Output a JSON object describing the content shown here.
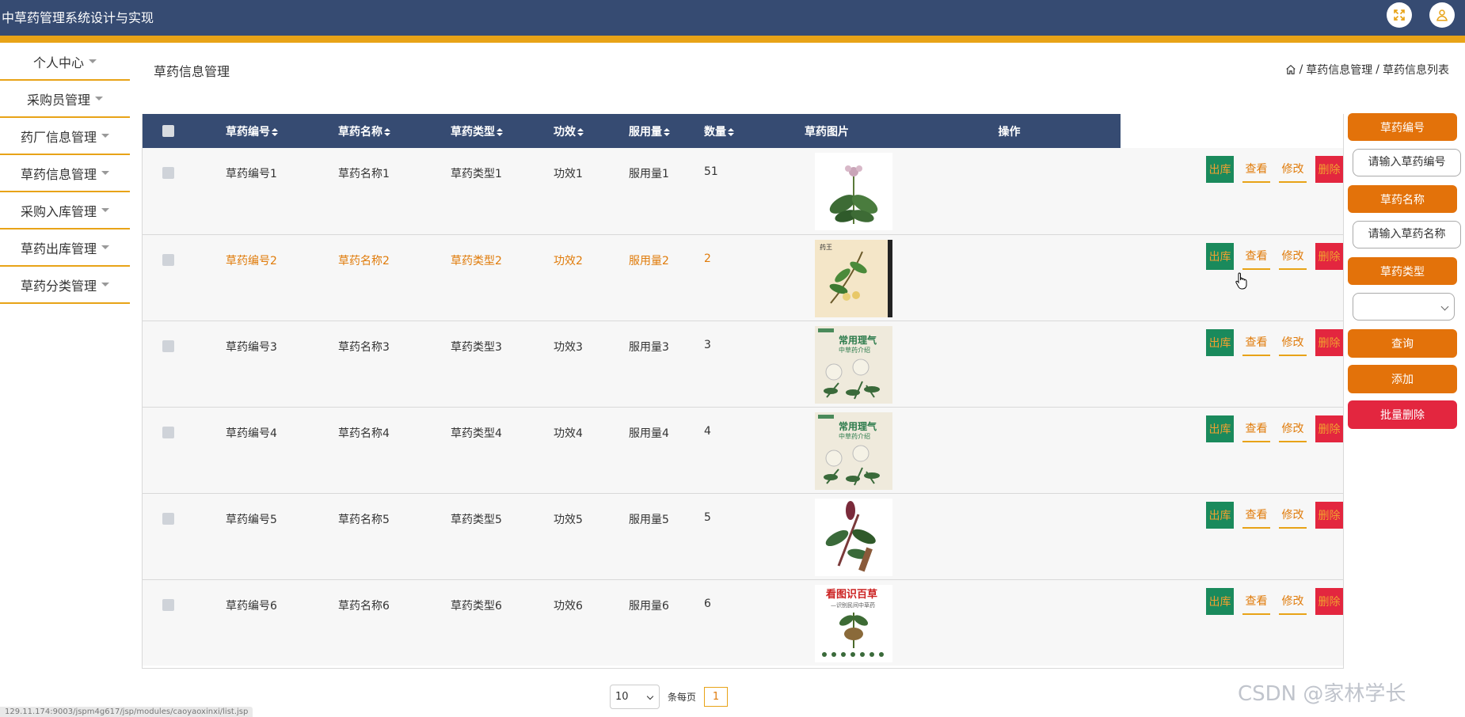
{
  "header": {
    "title": "中草药管理系统设计与实现",
    "fullscreen_icon": "fullscreen-icon",
    "user_icon": "user-icon"
  },
  "sidebar": {
    "items": [
      {
        "label": "个人中心"
      },
      {
        "label": "采购员管理"
      },
      {
        "label": "药厂信息管理"
      },
      {
        "label": "草药信息管理"
      },
      {
        "label": "采购入库管理"
      },
      {
        "label": "草药出库管理"
      },
      {
        "label": "草药分类管理"
      }
    ]
  },
  "page": {
    "heading": "草药信息管理",
    "breadcrumb": [
      "草药信息管理",
      "草药信息列表"
    ],
    "breadcrumb_sep": "/"
  },
  "table": {
    "headers": [
      "草药编号",
      "草药名称",
      "草药类型",
      "功效",
      "服用量",
      "数量",
      "草药图片",
      "操作"
    ],
    "ops": {
      "out": "出库",
      "view": "查看",
      "edit": "修改",
      "delete": "删除"
    },
    "rows": [
      {
        "code": "草药编号1",
        "name": "草药名称1",
        "type": "草药类型1",
        "effect": "功效1",
        "dose": "服用量1",
        "qty": "51",
        "img": "plant-illustration-1"
      },
      {
        "code": "草药编号2",
        "name": "草药名称2",
        "type": "草药类型2",
        "effect": "功效2",
        "dose": "服用量2",
        "qty": "2",
        "img": "herb-book-cover-1"
      },
      {
        "code": "草药编号3",
        "name": "草药名称3",
        "type": "草药类型3",
        "effect": "功效3",
        "dose": "服用量3",
        "qty": "3",
        "img": "herb-book-cover-2"
      },
      {
        "code": "草药编号4",
        "name": "草药名称4",
        "type": "草药类型4",
        "effect": "功效4",
        "dose": "服用量4",
        "qty": "4",
        "img": "herb-book-cover-2"
      },
      {
        "code": "草药编号5",
        "name": "草药名称5",
        "type": "草药类型5",
        "effect": "功效5",
        "dose": "服用量5",
        "qty": "5",
        "img": "plant-illustration-2"
      },
      {
        "code": "草药编号6",
        "name": "草药名称6",
        "type": "草药类型6",
        "effect": "功效6",
        "dose": "服用量6",
        "qty": "6",
        "img": "herb-book-cover-3"
      }
    ]
  },
  "search": {
    "code_label": "草药编号",
    "code_placeholder": "请输入草药编号",
    "name_label": "草药名称",
    "name_placeholder": "请输入草药名称",
    "type_label": "草药类型",
    "type_value": "",
    "query": "查询",
    "add": "添加",
    "batch_delete": "批量删除"
  },
  "pagination": {
    "page_size": "10",
    "per_page_label": "条每页",
    "current_page": "1"
  },
  "status_bar": {
    "url": "129.11.174:9003/jspm4g617/jsp/modules/caoyaoxinxi/list.jsp"
  },
  "watermark": "CSDN @家林学长",
  "colors": {
    "header_bg": "#364b72",
    "accent_orange": "#e3720a",
    "strip": "#e8a317",
    "danger": "#e3263f",
    "success": "#1a8a5c"
  }
}
